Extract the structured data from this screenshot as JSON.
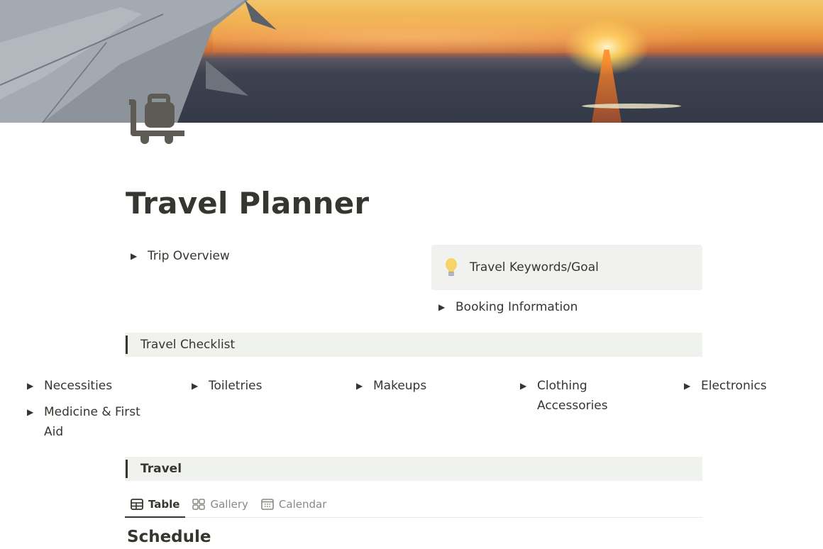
{
  "page": {
    "title": "Travel Planner",
    "icon": "luggage-cart-icon",
    "cover": "airplane-wing-sunset-cover"
  },
  "top_toggles": {
    "trip_overview": "Trip Overview",
    "booking_information": "Booking Information"
  },
  "callout": {
    "icon": "lightbulb-icon",
    "text": "Travel Keywords/Goal"
  },
  "sections": {
    "checklist_heading": "Travel Checklist",
    "travel_heading": "Travel"
  },
  "checklist": {
    "items": [
      {
        "label": "Necessities"
      },
      {
        "label": "Toiletries"
      },
      {
        "label": "Makeups"
      },
      {
        "label": "Clothing Accessories"
      },
      {
        "label": "Electronics"
      },
      {
        "label": "Medicine & First Aid"
      }
    ]
  },
  "views": {
    "tabs": [
      {
        "label": "Table",
        "icon": "table-icon",
        "active": true
      },
      {
        "label": "Gallery",
        "icon": "gallery-icon",
        "active": false
      },
      {
        "label": "Calendar",
        "icon": "calendar-icon",
        "active": false
      }
    ]
  },
  "database": {
    "title": "Schedule"
  },
  "colors": {
    "text": "#37352f",
    "muted": "#8a8984",
    "callout_bg": "#f1f1ef",
    "section_bg": "#f0f2ee"
  }
}
